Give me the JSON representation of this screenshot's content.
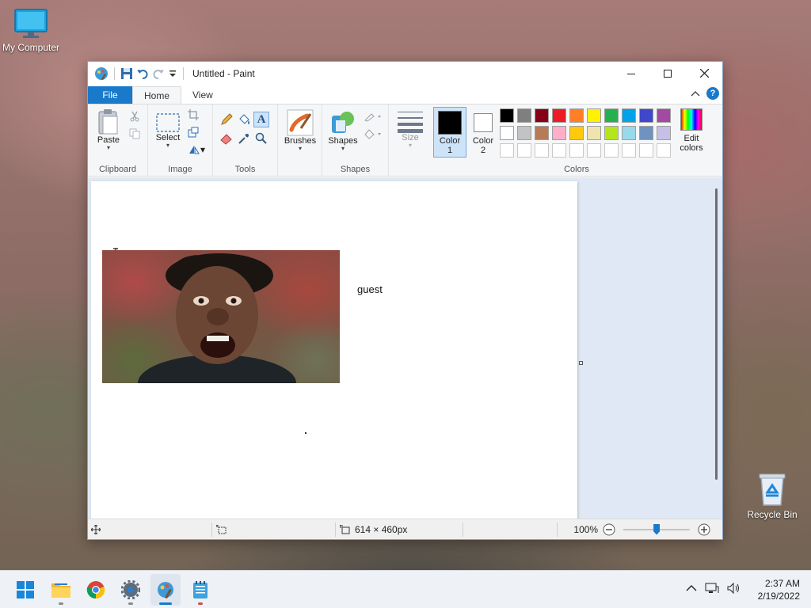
{
  "desktop": {
    "icons": [
      {
        "label": "My Computer",
        "icon": "monitor-icon"
      },
      {
        "label": "Recycle Bin",
        "icon": "recycle-bin-icon"
      }
    ]
  },
  "window": {
    "title": "Untitled - Paint",
    "tabs": {
      "file": "File",
      "home": "Home",
      "view": "View"
    },
    "help": "?",
    "ribbon": {
      "clipboard": {
        "label": "Clipboard",
        "paste": "Paste"
      },
      "image": {
        "label": "Image",
        "select": "Select"
      },
      "tools": {
        "label": "Tools"
      },
      "brushes": {
        "label": "Brushes"
      },
      "shapes": {
        "label": "Shapes",
        "shapes_btn": "Shapes"
      },
      "size": {
        "label": "Size"
      },
      "colors": {
        "label": "Colors",
        "color1_line1": "Color",
        "color1_line2": "1",
        "color2_line1": "Color",
        "color2_line2": "2",
        "edit_line1": "Edit",
        "edit_line2": "colors",
        "color1_value": "#000000",
        "color2_value": "#ffffff",
        "palette_row1": [
          "#000000",
          "#7f7f7f",
          "#880015",
          "#ed1c24",
          "#ff7f27",
          "#fff200",
          "#22b14c",
          "#00a2e8",
          "#3f48cc",
          "#a349a4"
        ],
        "palette_row2": [
          "#ffffff",
          "#c3c3c3",
          "#b97a57",
          "#ffaec9",
          "#ffc90e",
          "#efe4b0",
          "#b5e61d",
          "#99d9ea",
          "#7092be",
          "#c8bfe7"
        ],
        "palette_row3": [
          "#ffffff",
          "#ffffff",
          "#ffffff",
          "#ffffff",
          "#ffffff",
          "#ffffff",
          "#ffffff",
          "#ffffff",
          "#ffffff",
          "#ffffff"
        ]
      }
    },
    "canvas": {
      "text_box": "guest"
    },
    "status": {
      "dimensions": "614 × 460px",
      "zoom": "100%"
    }
  },
  "taskbar": {
    "apps": [
      "start-icon",
      "file-explorer-icon",
      "chrome-icon",
      "settings-icon",
      "paint-icon",
      "notepad-icon"
    ],
    "time": "2:37 AM",
    "date": "2/19/2022"
  }
}
